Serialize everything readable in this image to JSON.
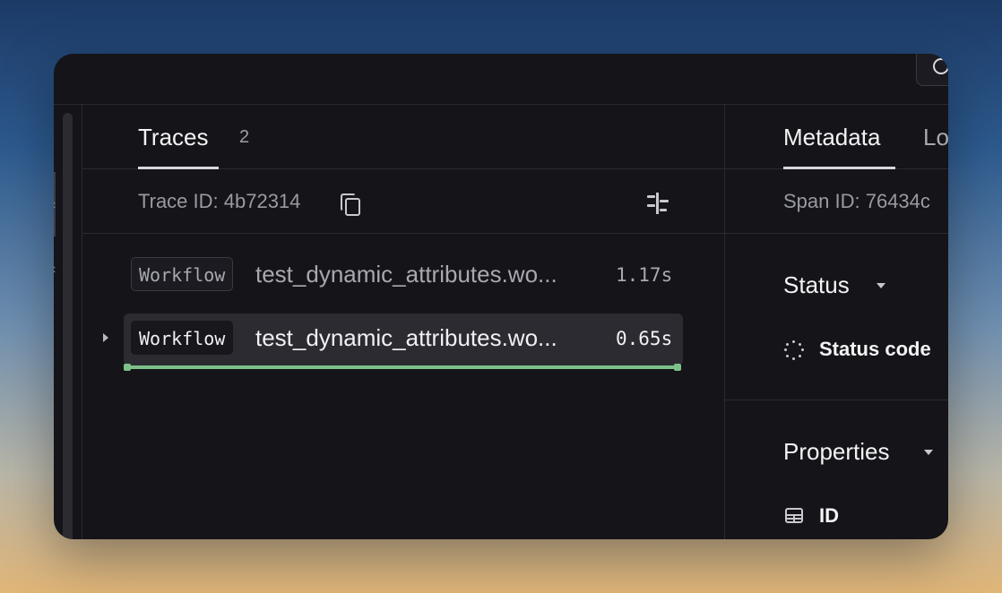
{
  "left_panel": {
    "tab_label": "Traces",
    "tab_count": "2",
    "trace_id_text": "Trace ID: 4b72314",
    "rows": [
      {
        "badge": "Workflow",
        "name": "test_dynamic_attributes.wo...",
        "duration": "1.17s",
        "selected": false
      },
      {
        "badge": "Workflow",
        "name": "test_dynamic_attributes.wo...",
        "duration": "0.65s",
        "selected": true,
        "progress": 1.0
      }
    ]
  },
  "right_panel": {
    "tabs": [
      "Metadata",
      "Lo"
    ],
    "span_id_text": "Span ID: 76434c",
    "status_section": {
      "title": "Status",
      "field_label": "Status code"
    },
    "properties_section": {
      "title": "Properties",
      "field_label": "ID"
    }
  },
  "colors": {
    "window_bg": "#141419",
    "selected_row_bg": "#2b2b31",
    "progress_green": "#7cc18a",
    "text_primary": "#f3f3f5",
    "text_muted": "#9a9aa3"
  },
  "icons": [
    "search-icon",
    "copy-icon",
    "align-icon",
    "expand-caret-icon",
    "caret-down-icon",
    "spinner-icon",
    "table-icon"
  ]
}
